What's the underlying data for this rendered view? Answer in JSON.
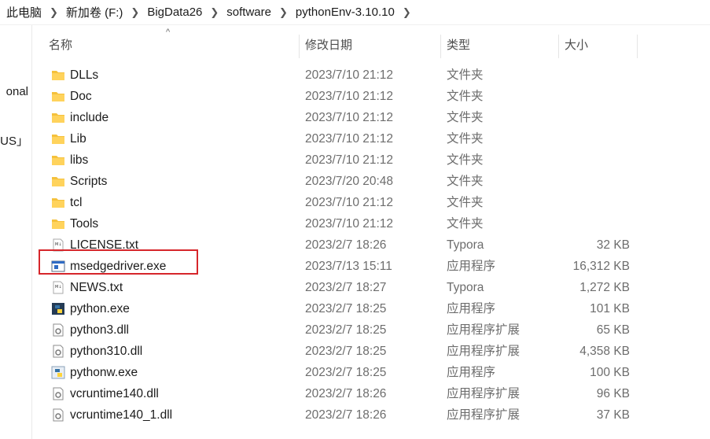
{
  "breadcrumb": [
    {
      "label": "此电脑"
    },
    {
      "label": "新加卷 (F:)"
    },
    {
      "label": "BigData26"
    },
    {
      "label": "software"
    },
    {
      "label": "pythonEnv-3.10.10"
    }
  ],
  "left_pane": {
    "fragment_1": "onal",
    "fragment_2": "US」"
  },
  "columns": {
    "name": "名称",
    "date": "修改日期",
    "type": "类型",
    "size": "大小"
  },
  "rows": [
    {
      "name": "DLLs",
      "date": "2023/7/10 21:12",
      "type": "文件夹",
      "size": "",
      "icon": "folder-icon"
    },
    {
      "name": "Doc",
      "date": "2023/7/10 21:12",
      "type": "文件夹",
      "size": "",
      "icon": "folder-icon"
    },
    {
      "name": "include",
      "date": "2023/7/10 21:12",
      "type": "文件夹",
      "size": "",
      "icon": "folder-icon"
    },
    {
      "name": "Lib",
      "date": "2023/7/10 21:12",
      "type": "文件夹",
      "size": "",
      "icon": "folder-icon"
    },
    {
      "name": "libs",
      "date": "2023/7/10 21:12",
      "type": "文件夹",
      "size": "",
      "icon": "folder-icon"
    },
    {
      "name": "Scripts",
      "date": "2023/7/20 20:48",
      "type": "文件夹",
      "size": "",
      "icon": "folder-icon"
    },
    {
      "name": "tcl",
      "date": "2023/7/10 21:12",
      "type": "文件夹",
      "size": "",
      "icon": "folder-icon"
    },
    {
      "name": "Tools",
      "date": "2023/7/10 21:12",
      "type": "文件夹",
      "size": "",
      "icon": "folder-icon"
    },
    {
      "name": "LICENSE.txt",
      "date": "2023/2/7 18:26",
      "type": "Typora",
      "size": "32 KB",
      "icon": "markdown-file-icon"
    },
    {
      "name": "msedgedriver.exe",
      "date": "2023/7/13 15:11",
      "type": "应用程序",
      "size": "16,312 KB",
      "icon": "application-icon",
      "highlighted": true
    },
    {
      "name": "NEWS.txt",
      "date": "2023/2/7 18:27",
      "type": "Typora",
      "size": "1,272 KB",
      "icon": "markdown-file-icon"
    },
    {
      "name": "python.exe",
      "date": "2023/2/7 18:25",
      "type": "应用程序",
      "size": "101 KB",
      "icon": "python-icon"
    },
    {
      "name": "python3.dll",
      "date": "2023/2/7 18:25",
      "type": "应用程序扩展",
      "size": "65 KB",
      "icon": "dll-file-icon"
    },
    {
      "name": "python310.dll",
      "date": "2023/2/7 18:25",
      "type": "应用程序扩展",
      "size": "4,358 KB",
      "icon": "dll-file-icon"
    },
    {
      "name": "pythonw.exe",
      "date": "2023/2/7 18:25",
      "type": "应用程序",
      "size": "100 KB",
      "icon": "python-icon"
    },
    {
      "name": "vcruntime140.dll",
      "date": "2023/2/7 18:26",
      "type": "应用程序扩展",
      "size": "96 KB",
      "icon": "dll-file-icon"
    },
    {
      "name": "vcruntime140_1.dll",
      "date": "2023/2/7 18:26",
      "type": "应用程序扩展",
      "size": "37 KB",
      "icon": "dll-file-icon"
    }
  ],
  "colors": {
    "folder": "#f5c13c",
    "highlight_box": "#d6262b",
    "python_blue": "#3572a5",
    "python_yellow": "#ffd43b"
  }
}
